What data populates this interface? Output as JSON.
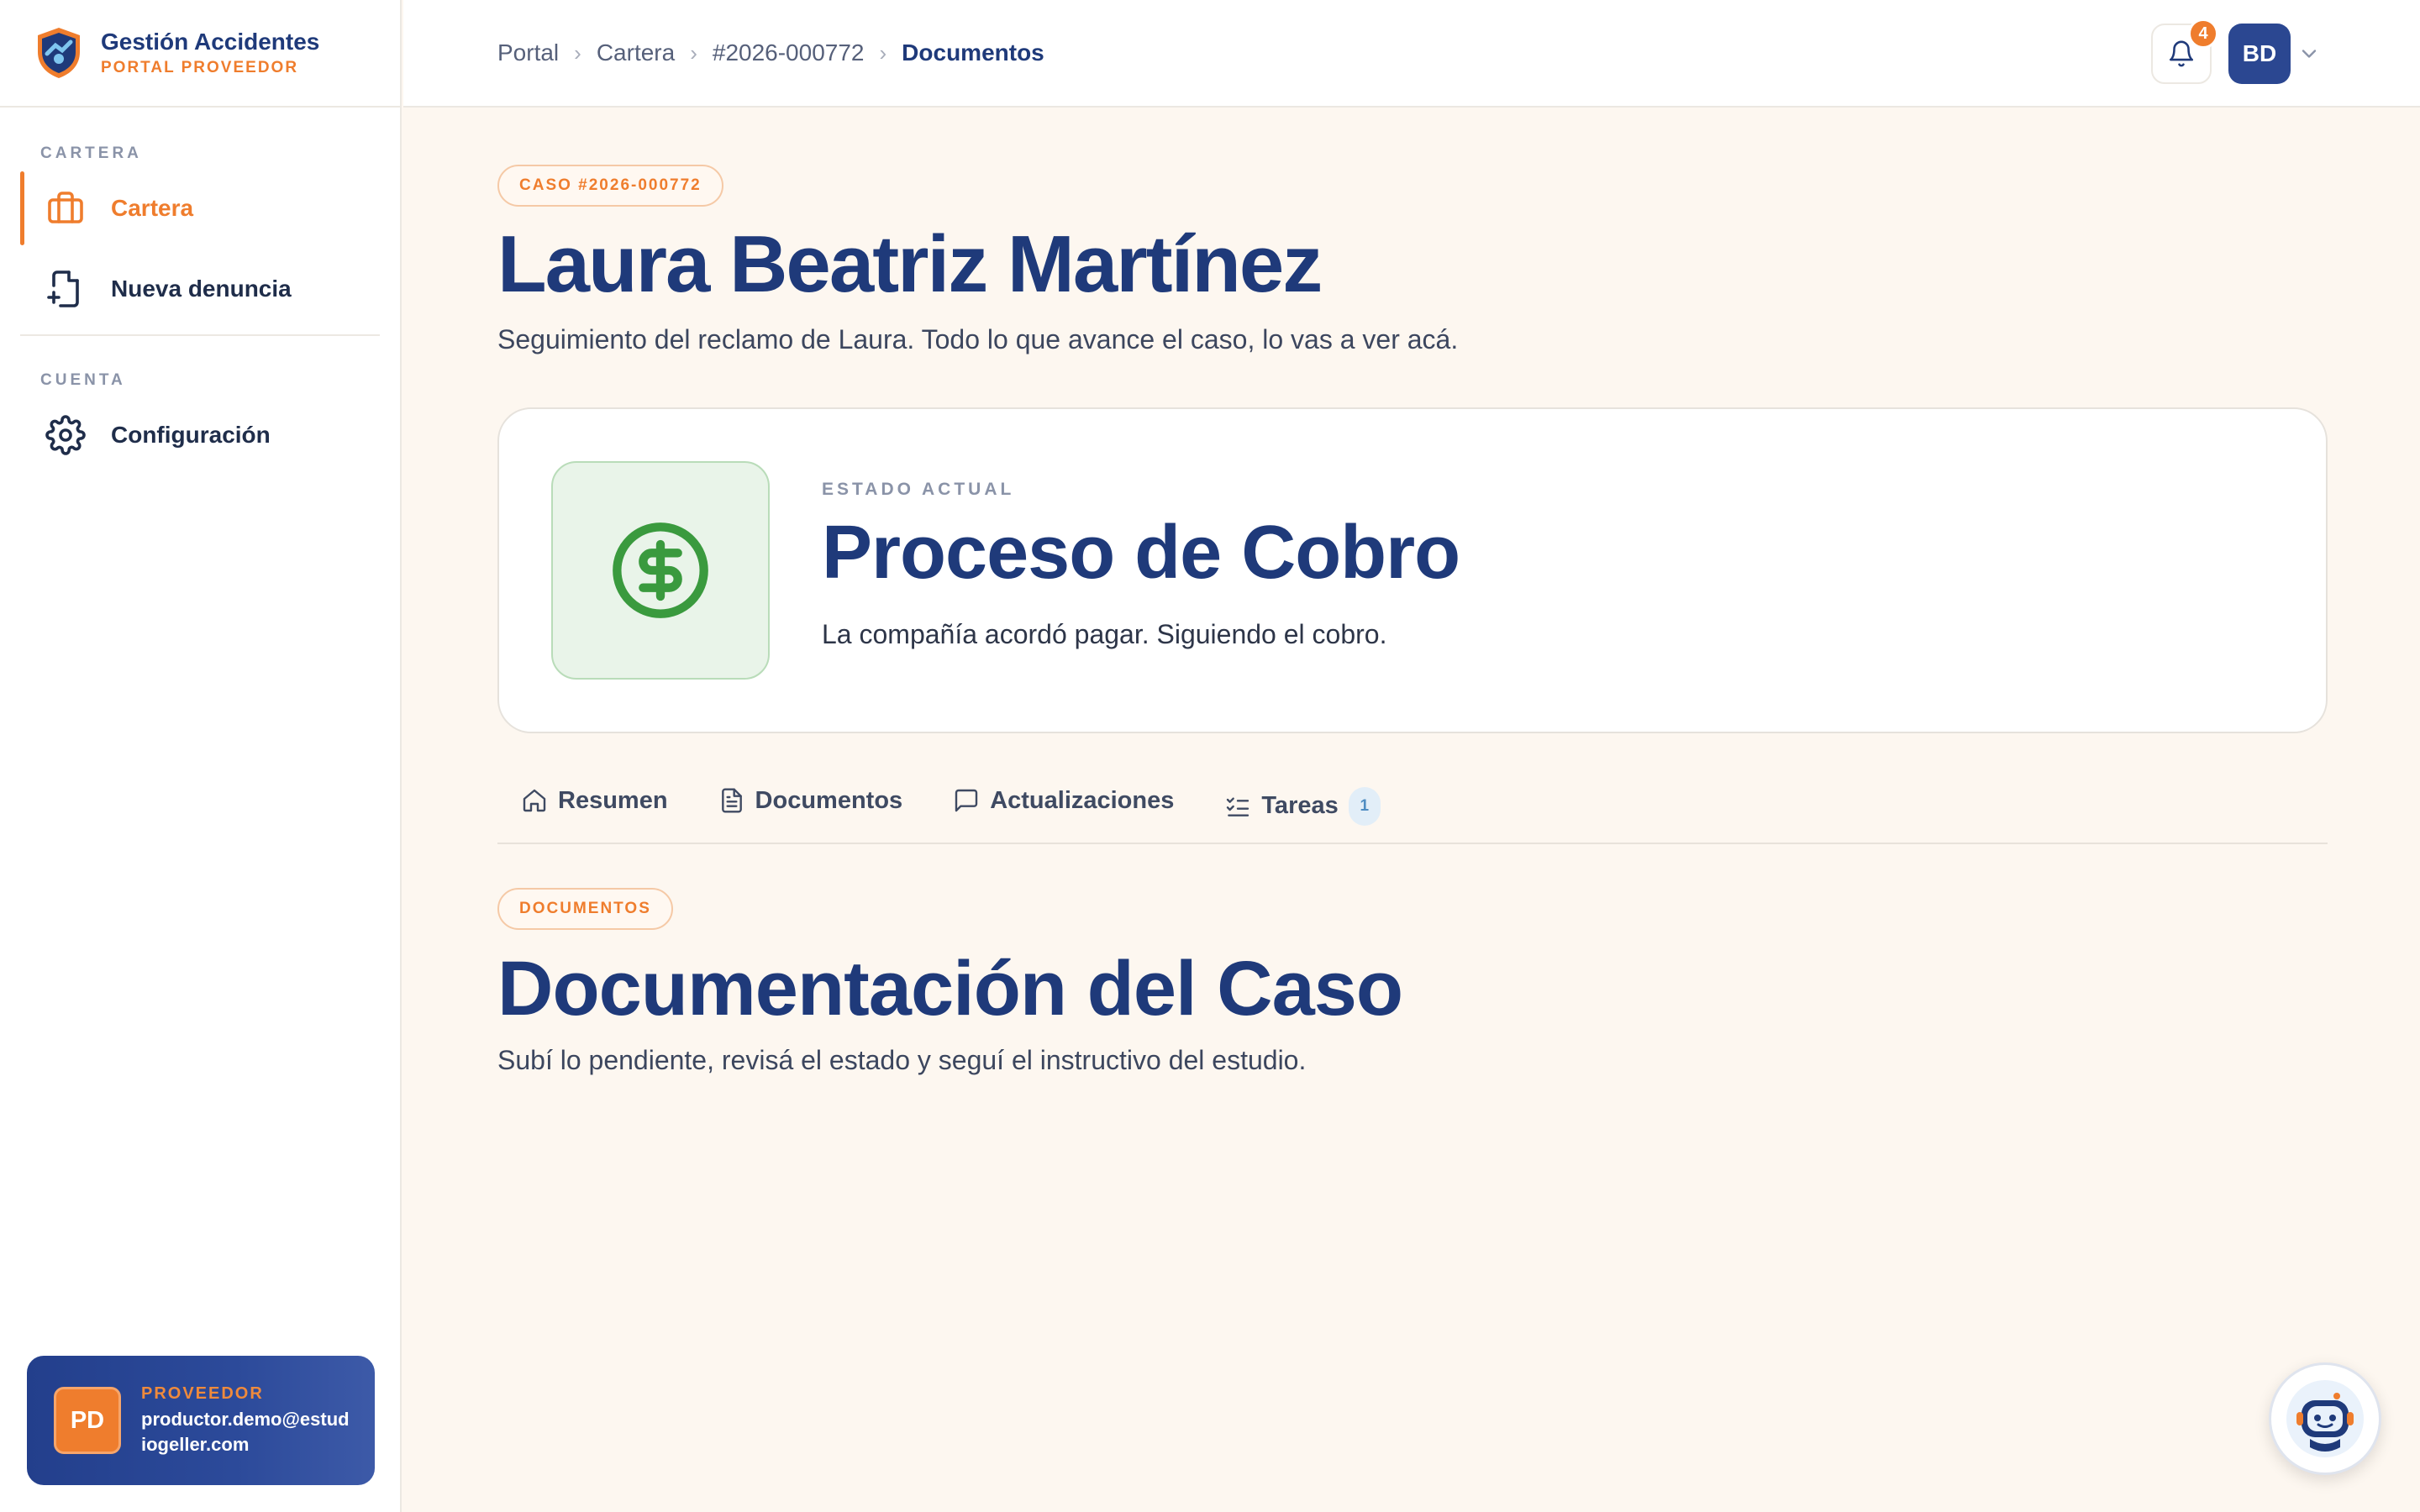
{
  "brand": {
    "title": "Gestión Accidentes",
    "subtitle": "PORTAL PROVEEDOR"
  },
  "sidebar": {
    "section_cartera": "CARTERA",
    "items_cartera": [
      {
        "label": "Cartera",
        "icon": "briefcase-icon",
        "active": true
      },
      {
        "label": "Nueva denuncia",
        "icon": "file-plus-icon",
        "active": false
      }
    ],
    "section_cuenta": "CUENTA",
    "items_cuenta": [
      {
        "label": "Configuración",
        "icon": "gear-icon",
        "active": false
      }
    ]
  },
  "user": {
    "initials": "PD",
    "role": "PROVEEDOR",
    "email": "productor.demo@estudiogeller.com"
  },
  "breadcrumb": [
    "Portal",
    "Cartera",
    "#2026-000772",
    "Documentos"
  ],
  "header": {
    "notification_count": "4",
    "avatar_initials": "BD"
  },
  "case": {
    "pill": "CASO #2026-000772",
    "name": "Laura Beatriz Martínez",
    "description": "Seguimiento del reclamo de Laura. Todo lo que avance el caso, lo vas a ver acá."
  },
  "status": {
    "eyebrow": "ESTADO ACTUAL",
    "title": "Proceso de Cobro",
    "description": "La compañía acordó pagar. Siguiendo el cobro.",
    "icon": "dollar-circle-icon",
    "color": "#3a9a3e"
  },
  "tabs": [
    {
      "label": "Resumen",
      "icon": "home-icon"
    },
    {
      "label": "Documentos",
      "icon": "document-icon"
    },
    {
      "label": "Actualizaciones",
      "icon": "message-icon"
    },
    {
      "label": "Tareas",
      "icon": "checklist-icon",
      "count": "1"
    }
  ],
  "documents": {
    "pill": "DOCUMENTOS",
    "title": "Documentación del Caso",
    "description": "Subí lo pendiente, revisá el estado y seguí el instructivo del estudio."
  },
  "colors": {
    "primary": "#1f3a7a",
    "accent": "#ef7d2d",
    "background": "#fdf7f0"
  }
}
